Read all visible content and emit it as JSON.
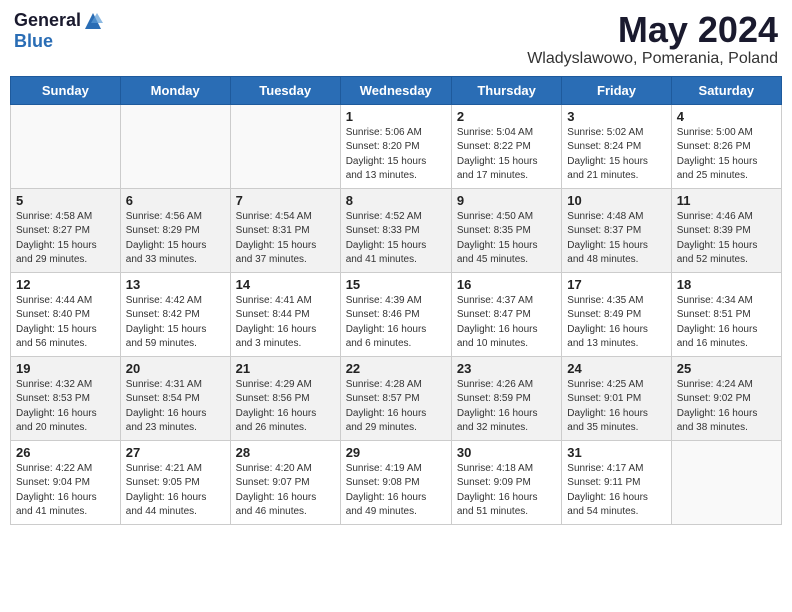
{
  "header": {
    "logo_general": "General",
    "logo_blue": "Blue",
    "month_title": "May 2024",
    "location": "Wladyslawowo, Pomerania, Poland"
  },
  "weekdays": [
    "Sunday",
    "Monday",
    "Tuesday",
    "Wednesday",
    "Thursday",
    "Friday",
    "Saturday"
  ],
  "weeks": [
    [
      {
        "day": "",
        "info": ""
      },
      {
        "day": "",
        "info": ""
      },
      {
        "day": "",
        "info": ""
      },
      {
        "day": "1",
        "info": "Sunrise: 5:06 AM\nSunset: 8:20 PM\nDaylight: 15 hours\nand 13 minutes."
      },
      {
        "day": "2",
        "info": "Sunrise: 5:04 AM\nSunset: 8:22 PM\nDaylight: 15 hours\nand 17 minutes."
      },
      {
        "day": "3",
        "info": "Sunrise: 5:02 AM\nSunset: 8:24 PM\nDaylight: 15 hours\nand 21 minutes."
      },
      {
        "day": "4",
        "info": "Sunrise: 5:00 AM\nSunset: 8:26 PM\nDaylight: 15 hours\nand 25 minutes."
      }
    ],
    [
      {
        "day": "5",
        "info": "Sunrise: 4:58 AM\nSunset: 8:27 PM\nDaylight: 15 hours\nand 29 minutes."
      },
      {
        "day": "6",
        "info": "Sunrise: 4:56 AM\nSunset: 8:29 PM\nDaylight: 15 hours\nand 33 minutes."
      },
      {
        "day": "7",
        "info": "Sunrise: 4:54 AM\nSunset: 8:31 PM\nDaylight: 15 hours\nand 37 minutes."
      },
      {
        "day": "8",
        "info": "Sunrise: 4:52 AM\nSunset: 8:33 PM\nDaylight: 15 hours\nand 41 minutes."
      },
      {
        "day": "9",
        "info": "Sunrise: 4:50 AM\nSunset: 8:35 PM\nDaylight: 15 hours\nand 45 minutes."
      },
      {
        "day": "10",
        "info": "Sunrise: 4:48 AM\nSunset: 8:37 PM\nDaylight: 15 hours\nand 48 minutes."
      },
      {
        "day": "11",
        "info": "Sunrise: 4:46 AM\nSunset: 8:39 PM\nDaylight: 15 hours\nand 52 minutes."
      }
    ],
    [
      {
        "day": "12",
        "info": "Sunrise: 4:44 AM\nSunset: 8:40 PM\nDaylight: 15 hours\nand 56 minutes."
      },
      {
        "day": "13",
        "info": "Sunrise: 4:42 AM\nSunset: 8:42 PM\nDaylight: 15 hours\nand 59 minutes."
      },
      {
        "day": "14",
        "info": "Sunrise: 4:41 AM\nSunset: 8:44 PM\nDaylight: 16 hours\nand 3 minutes."
      },
      {
        "day": "15",
        "info": "Sunrise: 4:39 AM\nSunset: 8:46 PM\nDaylight: 16 hours\nand 6 minutes."
      },
      {
        "day": "16",
        "info": "Sunrise: 4:37 AM\nSunset: 8:47 PM\nDaylight: 16 hours\nand 10 minutes."
      },
      {
        "day": "17",
        "info": "Sunrise: 4:35 AM\nSunset: 8:49 PM\nDaylight: 16 hours\nand 13 minutes."
      },
      {
        "day": "18",
        "info": "Sunrise: 4:34 AM\nSunset: 8:51 PM\nDaylight: 16 hours\nand 16 minutes."
      }
    ],
    [
      {
        "day": "19",
        "info": "Sunrise: 4:32 AM\nSunset: 8:53 PM\nDaylight: 16 hours\nand 20 minutes."
      },
      {
        "day": "20",
        "info": "Sunrise: 4:31 AM\nSunset: 8:54 PM\nDaylight: 16 hours\nand 23 minutes."
      },
      {
        "day": "21",
        "info": "Sunrise: 4:29 AM\nSunset: 8:56 PM\nDaylight: 16 hours\nand 26 minutes."
      },
      {
        "day": "22",
        "info": "Sunrise: 4:28 AM\nSunset: 8:57 PM\nDaylight: 16 hours\nand 29 minutes."
      },
      {
        "day": "23",
        "info": "Sunrise: 4:26 AM\nSunset: 8:59 PM\nDaylight: 16 hours\nand 32 minutes."
      },
      {
        "day": "24",
        "info": "Sunrise: 4:25 AM\nSunset: 9:01 PM\nDaylight: 16 hours\nand 35 minutes."
      },
      {
        "day": "25",
        "info": "Sunrise: 4:24 AM\nSunset: 9:02 PM\nDaylight: 16 hours\nand 38 minutes."
      }
    ],
    [
      {
        "day": "26",
        "info": "Sunrise: 4:22 AM\nSunset: 9:04 PM\nDaylight: 16 hours\nand 41 minutes."
      },
      {
        "day": "27",
        "info": "Sunrise: 4:21 AM\nSunset: 9:05 PM\nDaylight: 16 hours\nand 44 minutes."
      },
      {
        "day": "28",
        "info": "Sunrise: 4:20 AM\nSunset: 9:07 PM\nDaylight: 16 hours\nand 46 minutes."
      },
      {
        "day": "29",
        "info": "Sunrise: 4:19 AM\nSunset: 9:08 PM\nDaylight: 16 hours\nand 49 minutes."
      },
      {
        "day": "30",
        "info": "Sunrise: 4:18 AM\nSunset: 9:09 PM\nDaylight: 16 hours\nand 51 minutes."
      },
      {
        "day": "31",
        "info": "Sunrise: 4:17 AM\nSunset: 9:11 PM\nDaylight: 16 hours\nand 54 minutes."
      },
      {
        "day": "",
        "info": ""
      }
    ]
  ]
}
